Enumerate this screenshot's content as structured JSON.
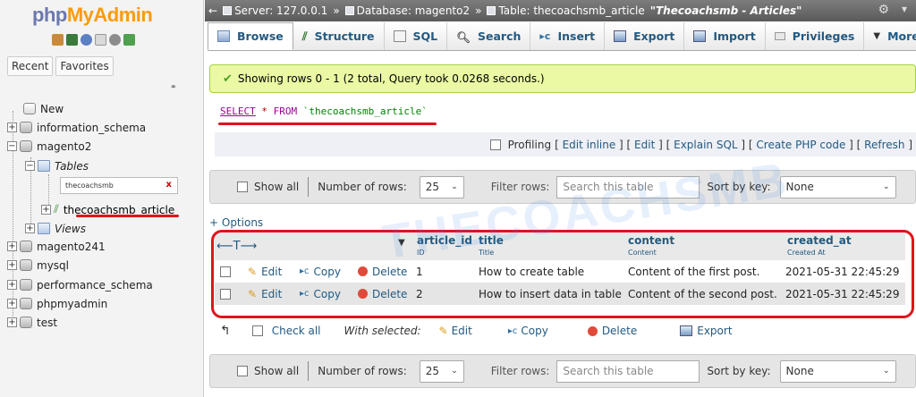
{
  "app": {
    "logo_php": "php",
    "logo_myadmin": "MyAdmin"
  },
  "nav": {
    "tabs": [
      "Recent",
      "Favorites"
    ],
    "tree": {
      "new": "New",
      "information_schema": "information_schema",
      "magento2": "magento2",
      "tables": "Tables",
      "filter_value": "thecoachsmb",
      "filter_clear": "x",
      "selected_table": "thecoachsmb_article",
      "views": "Views",
      "magento241": "magento241",
      "mysql": "mysql",
      "performance_schema": "performance_schema",
      "phpmyadmin": "phpmyadmin",
      "test": "test"
    }
  },
  "breadcrumb": {
    "server": "Server: 127.0.0.1",
    "database": "Database: magento2",
    "table": "Table: thecoachsmb_article",
    "comment": "\"Thecoachsmb - Articles\"",
    "sep": "»"
  },
  "tabs": [
    {
      "label": "Browse"
    },
    {
      "label": "Structure"
    },
    {
      "label": "SQL"
    },
    {
      "label": "Search"
    },
    {
      "label": "Insert"
    },
    {
      "label": "Export"
    },
    {
      "label": "Import"
    },
    {
      "label": "Privileges"
    },
    {
      "label": "More"
    }
  ],
  "message": {
    "success": "Showing rows 0 - 1 (2 total, Query took 0.0268 seconds.)"
  },
  "sql": {
    "select": "SELECT",
    "star": "*",
    "from": "FROM",
    "table": "`thecoachsmb_article`"
  },
  "profiling": {
    "label": "Profiling",
    "links": [
      "Edit inline",
      "Edit",
      "Explain SQL",
      "Create PHP code",
      "Refresh"
    ]
  },
  "navbar": {
    "show_all": "Show all",
    "rows_label": "Number of rows:",
    "rows_value": "25",
    "filter_label": "Filter rows:",
    "filter_placeholder": "Search this table",
    "sort_label": "Sort by key:",
    "sort_value": "None"
  },
  "options_link": "+ Options",
  "table": {
    "columns": [
      {
        "name": "article_id",
        "comment": "ID"
      },
      {
        "name": "title",
        "comment": "Title"
      },
      {
        "name": "content",
        "comment": "Content"
      },
      {
        "name": "created_at",
        "comment": "Created At"
      }
    ],
    "actions": {
      "edit": "Edit",
      "copy": "Copy",
      "delete": "Delete"
    },
    "rows": [
      {
        "article_id": "1",
        "title": "How to create table",
        "content": "Content of the first post.",
        "created_at": "2021-05-31 22:45:29"
      },
      {
        "article_id": "2",
        "title": "How to insert data in table",
        "content": "Content of the second post.",
        "created_at": "2021-05-31 22:45:29"
      }
    ]
  },
  "with_selected": {
    "check_all": "Check all",
    "label": "With selected:",
    "edit": "Edit",
    "copy": "Copy",
    "delete": "Delete",
    "export": "Export"
  },
  "watermark": "THECOACHSMB",
  "colors": {
    "link": "#235a81",
    "success_bg": "#ebf8a4",
    "highlight_red": "#e0141c",
    "topbar": "#6a6a6a"
  }
}
